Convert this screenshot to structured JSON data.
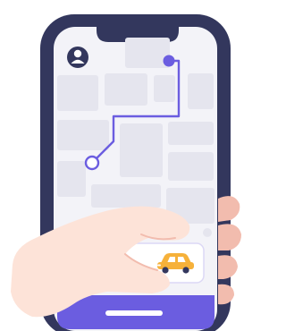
{
  "colors": {
    "frame": "#33375d",
    "screen_bg": "#f3f3f8",
    "map_block": "#e5e5ee",
    "route": "#6b5de0",
    "accent": "#6b5de0",
    "skin_light": "#fde3d8",
    "skin_dark": "#f2bcae",
    "car_body": "#f6b13a",
    "card_bg": "#ffffff"
  },
  "icons": {
    "profile": "user-avatar-icon",
    "destination": "destination-pin-icon",
    "origin": "origin-pin-icon",
    "vehicle": "taxi-car-icon"
  }
}
